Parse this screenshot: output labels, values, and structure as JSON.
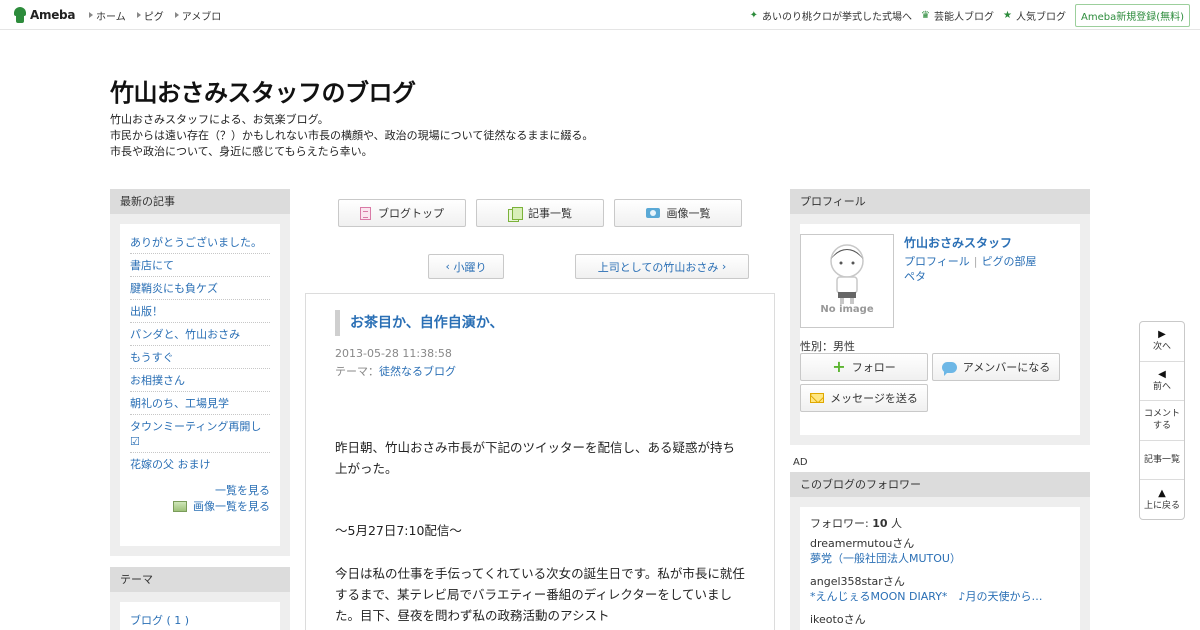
{
  "topbar": {
    "logo_text": "Ameba",
    "nav": [
      "ホーム",
      "ピグ",
      "アメブロ"
    ],
    "right_links": [
      {
        "label": "あいのり桃クロが挙式した式場へ",
        "icon": "sparkle-icon"
      },
      {
        "label": "芸能人ブログ",
        "icon": "crown-icon"
      },
      {
        "label": "人気ブログ",
        "icon": "star-icon"
      }
    ],
    "register_label": "Ameba新規登録(無料)"
  },
  "header": {
    "title": "竹山おさみスタッフのブログ",
    "description": [
      "竹山おさみスタッフによる、お気楽ブログ。",
      "市民からは遠い存在（？）かもしれない市長の横顔や、政治の現場について徒然なるままに綴る。",
      "市長や政治について、身近に感じてもらえたら幸い。"
    ]
  },
  "left": {
    "recent_heading": "最新の記事",
    "recent_articles": [
      "ありがとうございました。",
      "書店にて",
      "腱鞘炎にも負ケズ",
      "出版！",
      "パンダと、竹山おさみ",
      "もうすぐ",
      "お相撲さん",
      "朝礼のち、工場見学",
      "タウンミーティング再開し☑",
      "花嫁の父 おまけ"
    ],
    "list_link": "一覧を見る",
    "image_list_link": "画像一覧を見る",
    "theme_heading": "テーマ",
    "theme_items": [
      "ブログ ( 1 )"
    ]
  },
  "center": {
    "nav_buttons": {
      "blog_top": "ブログトップ",
      "article_list": "記事一覧",
      "image_list": "画像一覧"
    },
    "prev_label": "小躍り",
    "next_label": "上司としての竹山おさみ",
    "entry": {
      "title": "お茶目か、自作自演か、",
      "date": "2013-05-28 11:38:58",
      "theme_prefix": "テーマ：",
      "theme": "徒然なるブログ",
      "paragraphs": [
        "昨日朝、竹山おさみ市長が下記のツイッターを配信し、ある疑惑が持ち上がった。",
        "～5月27日7:10配信～",
        "今日は私の仕事を手伝ってくれている次女の誕生日です。私が市長に就任するまで、某テレビ局でバラエティー番組のディレクターをしていました。目下、昼夜を問わず私の政務活動のアシスト"
      ]
    }
  },
  "right": {
    "profile_heading": "プロフィール",
    "avatar_text": "No image",
    "name": "竹山おさみスタッフ",
    "links": [
      "プロフィール",
      "ピグの部屋",
      "ペタ"
    ],
    "gender": "性別：男性",
    "buttons": {
      "follow": "フォロー",
      "amember": "アメンバーになる",
      "message": "メッセージを送る"
    },
    "ad_label": "AD",
    "followers_heading": "このブログのフォロワー",
    "followers_count_prefix": "フォロワー: ",
    "followers_count": "10",
    "followers_count_suffix": " 人",
    "followers": [
      {
        "user": "dreamermutouさん",
        "blog": "夢党（一般社団法人MUTOU）"
      },
      {
        "user": "angel358starさん",
        "blog": "*えんじぇるMOON DIARY*　♪月の天使から…"
      },
      {
        "user": "ikeotoさん",
        "blog": ""
      }
    ]
  },
  "sidenav": {
    "next": "次へ",
    "prev": "前へ",
    "comment_1": "コメント",
    "comment_2": "する",
    "articles": "記事一覧",
    "top": "上に戻る"
  }
}
